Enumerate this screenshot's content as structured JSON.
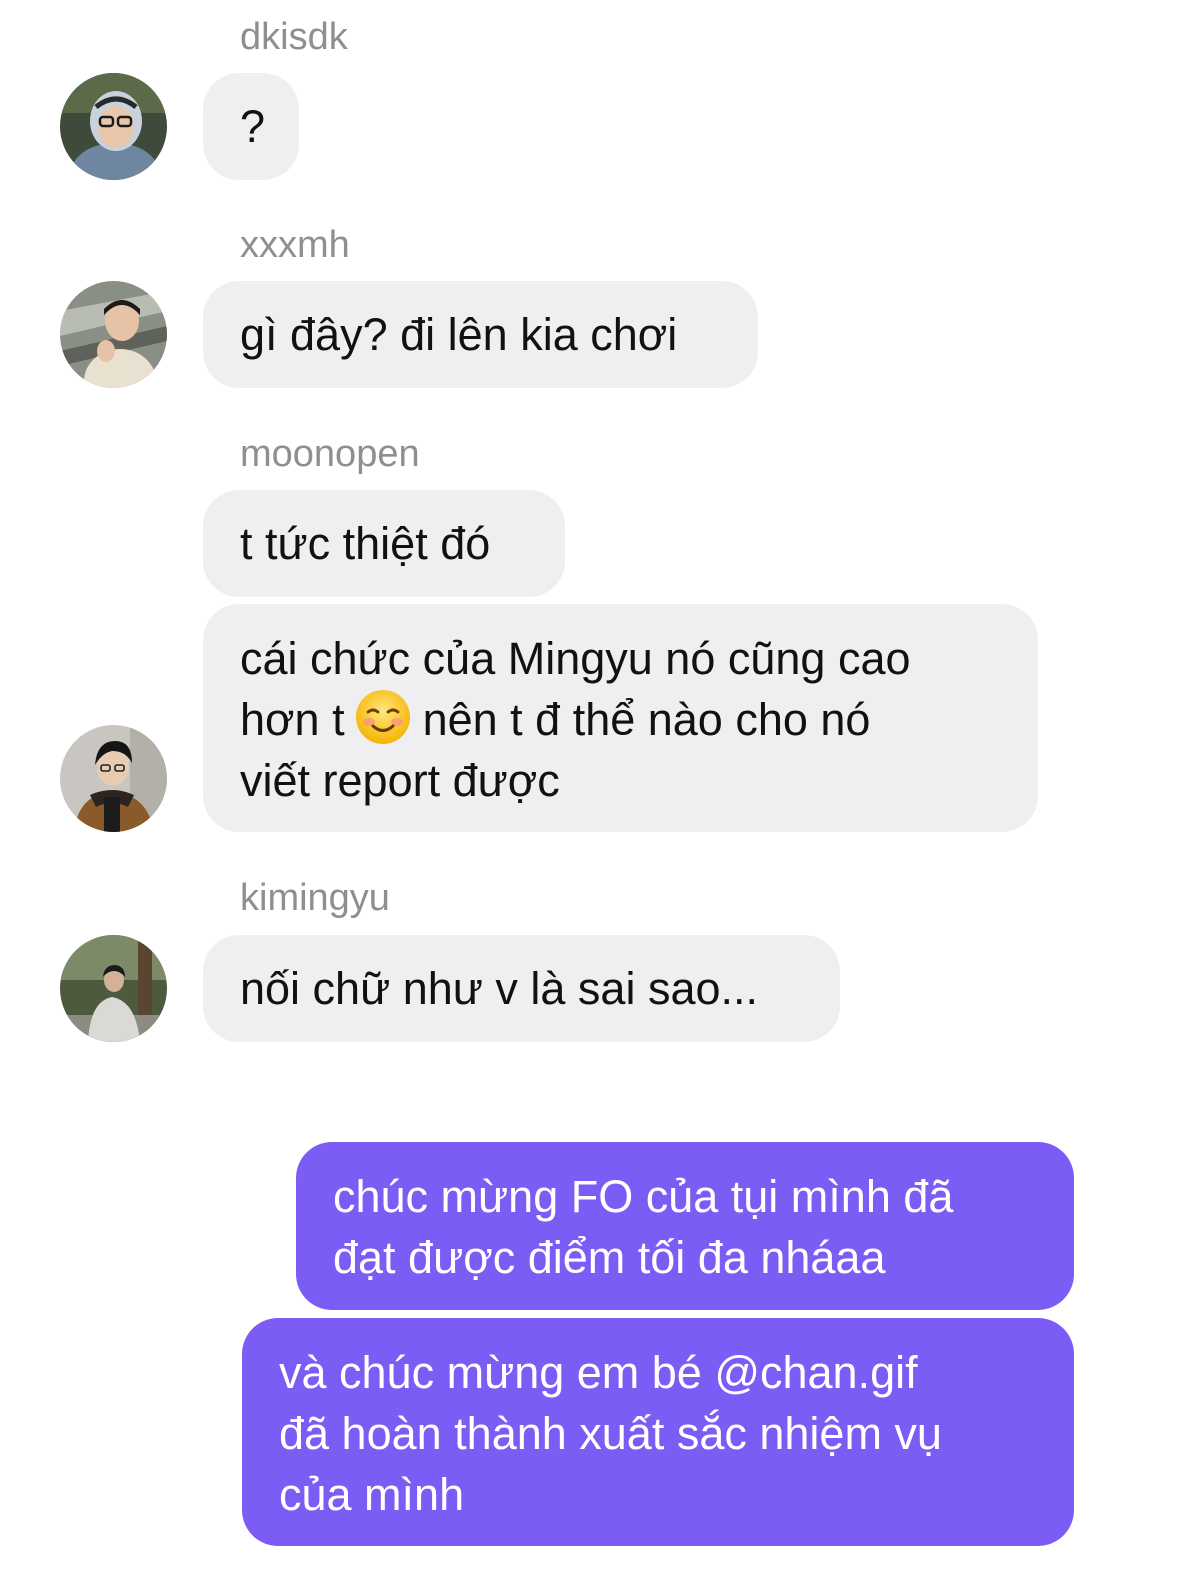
{
  "chat": {
    "messages": [
      {
        "sender": "dkisdk",
        "avatar": "avatar-dkisdk",
        "lines": [
          "?"
        ]
      },
      {
        "sender": "xxxmh",
        "avatar": "avatar-xxxmh",
        "lines": [
          "gì đây? đi lên kia chơi"
        ]
      },
      {
        "sender": "moonopen",
        "avatar": "",
        "lines": [
          "t tức thiệt đó"
        ]
      },
      {
        "sender": "moonopen",
        "avatar": "avatar-moonopen",
        "line1": "cái chức của Mingyu nó cũng cao",
        "line2_before_emoji": "hơn t",
        "emoji": "smiling-face-emoji",
        "line2_after_emoji": "nên t đ thể nào cho nó",
        "line3": "viết report được"
      },
      {
        "sender": "kimingyu",
        "avatar": "avatar-kimingyu",
        "lines": [
          "nối chữ như v là sai sao..."
        ]
      }
    ],
    "outgoing": [
      {
        "lines": [
          "chúc mừng FO của tụi mình đã",
          "đạt được điểm tối đa nháaa"
        ]
      },
      {
        "lines": [
          "và chúc mừng em bé @chan.gif",
          "đã hoàn thành xuất sắc nhiệm vụ",
          "của mình"
        ]
      }
    ]
  },
  "colors": {
    "incoming_bubble": "#efeff2",
    "outgoing_bubble": "#7b5cf5",
    "sender_name": "#8e8e93"
  }
}
